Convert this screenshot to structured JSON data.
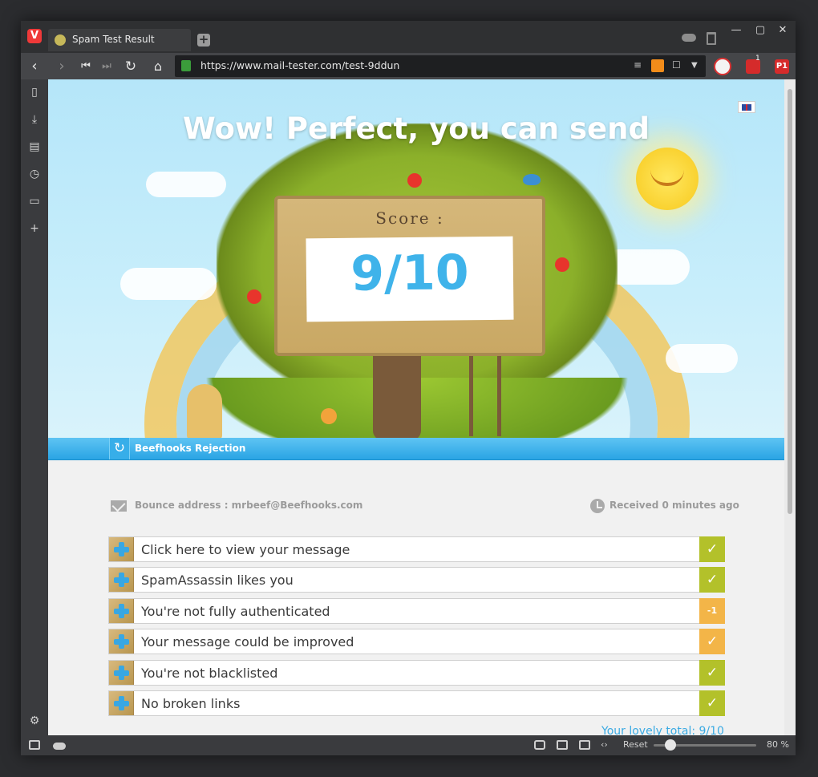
{
  "browser": {
    "tab_title": "Spam Test Result",
    "url": "https://www.mail-tester.com/test-9ddun",
    "extension_badge": "1",
    "ext_p_label": "P1",
    "window_controls": [
      "—",
      "▢",
      "✕"
    ]
  },
  "hero": {
    "title": "Wow! Perfect, you can send",
    "score_label": "Score :",
    "score_value": "9/10"
  },
  "band": {
    "label": "Beefhooks Rejection"
  },
  "info": {
    "bounce": "Bounce address : mrbeef@Beefhooks.com",
    "received": "Received 0 minutes ago"
  },
  "results": [
    {
      "label": "Click here to view your message",
      "status": "✓",
      "kind": "ok"
    },
    {
      "label": "SpamAssassin likes you",
      "status": "✓",
      "kind": "ok"
    },
    {
      "label": "You're not fully authenticated",
      "status": "-1",
      "kind": "warn"
    },
    {
      "label": "Your message could be improved",
      "status": "✓",
      "kind": "warn"
    },
    {
      "label": "You're not blacklisted",
      "status": "✓",
      "kind": "ok"
    },
    {
      "label": "No broken links",
      "status": "✓",
      "kind": "ok"
    }
  ],
  "total": "Your lovely total: 9/10",
  "statusbar": {
    "reset_label": "Reset",
    "zoom": "80 %",
    "zoom_level": 0.8
  },
  "colors": {
    "accent_blue": "#3aaae3",
    "ok_green": "#b3c12a",
    "warn_orange": "#f3b548"
  }
}
